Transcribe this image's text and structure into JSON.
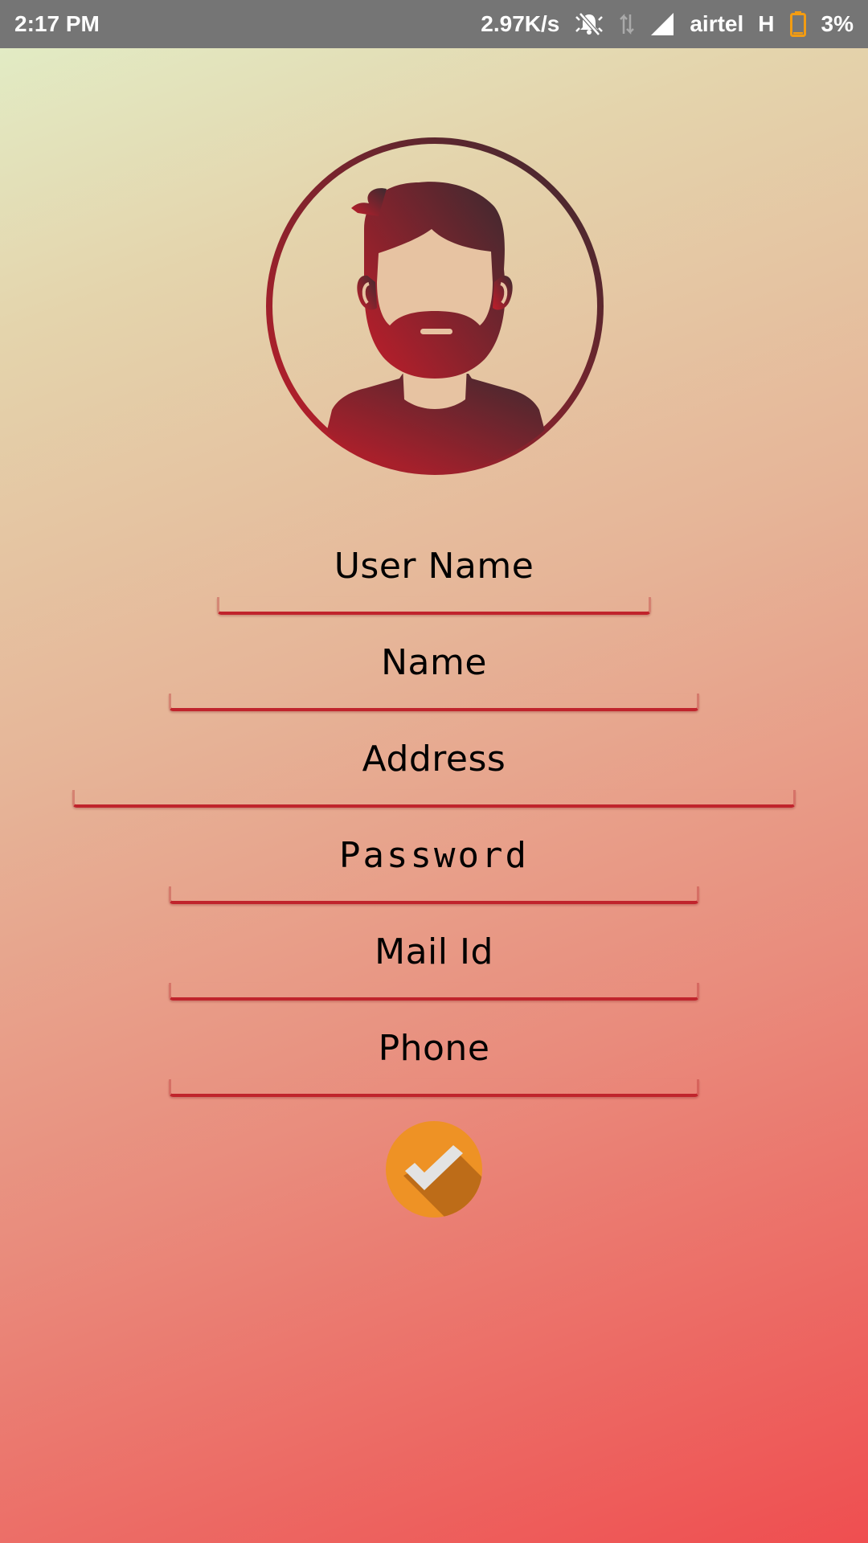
{
  "status_bar": {
    "time": "2:17 PM",
    "network_speed": "2.97K/s",
    "carrier": "airtel",
    "network_type": "H",
    "battery": "3%",
    "icons": [
      "notifications-off-icon",
      "data-arrows-icon",
      "signal-icon",
      "battery-icon"
    ]
  },
  "avatar": {
    "icon": "male-avatar-icon"
  },
  "form": {
    "user_name_placeholder": "User Name",
    "name_placeholder": "Name",
    "address_placeholder": "Address",
    "password_placeholder": "Password",
    "mail_placeholder": "Mail Id",
    "phone_placeholder": "Phone"
  },
  "submit": {
    "icon": "check-icon"
  },
  "colors": {
    "accent": "#c0242c",
    "submit_bg": "#ee9225",
    "submit_shadow": "#bd6c18",
    "check": "#e3e3e3",
    "status_bar": "#757575",
    "battery": "#f39c12"
  }
}
